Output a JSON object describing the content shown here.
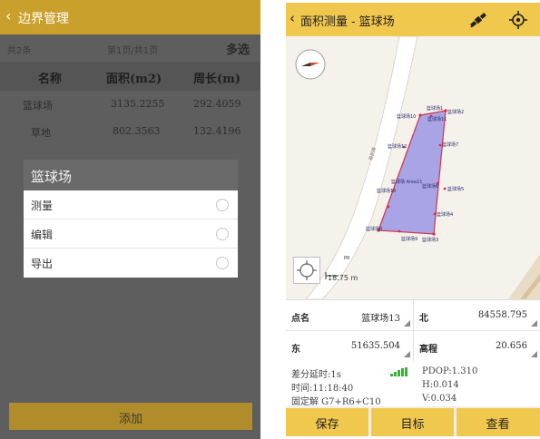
{
  "left": {
    "title": "边界管理",
    "status": {
      "total": "共2条",
      "page": "第1页/共1页",
      "multi_select": "多选"
    },
    "table": {
      "headers": [
        "名称",
        "面积(m2)",
        "周长(m)"
      ],
      "rows": [
        [
          "篮球场",
          "3135.2255",
          "292.4059"
        ],
        [
          "草地",
          "802.3563",
          "132.4196"
        ]
      ]
    },
    "dialog": {
      "title": "篮球场",
      "options": [
        "测量",
        "编辑",
        "导出"
      ]
    },
    "add_button": "添加"
  },
  "right": {
    "title": "面积测量 - 篮球场",
    "map": {
      "scale_label": "18.75 m",
      "road_label": "居民路",
      "area_label": "篮球场 Area11",
      "point_labels": [
        "篮球场1",
        "篮球场2",
        "篮球场3",
        "篮球场4",
        "篮球场5",
        "篮球场6",
        "篮球场7",
        "篮球场8",
        "篮球场9",
        "篮球场10",
        "篮球场11",
        "篮球场12",
        "篮球场13"
      ],
      "point_tag": "P8"
    },
    "form": {
      "point_name_label": "点名",
      "point_name_value": "篮球场13",
      "north_label": "北",
      "north_value": "84558.795",
      "east_label": "东",
      "east_value": "51635.504",
      "elev_label": "高程",
      "elev_value": "20.656"
    },
    "info": {
      "diff_delay": "差分延时:1s",
      "pdop": "PDOP:1.310",
      "time": "时间:11:18:40",
      "h": "H:0.014",
      "fix": "固定解  G7+R6+C10",
      "v": "V:0.034"
    },
    "buttons": {
      "save": "保存",
      "target": "目标",
      "view": "查看"
    },
    "colors": {
      "accent": "#f1c84e",
      "polygon_fill": "#a9a4e6",
      "polygon_edge": "#d0334a"
    }
  }
}
